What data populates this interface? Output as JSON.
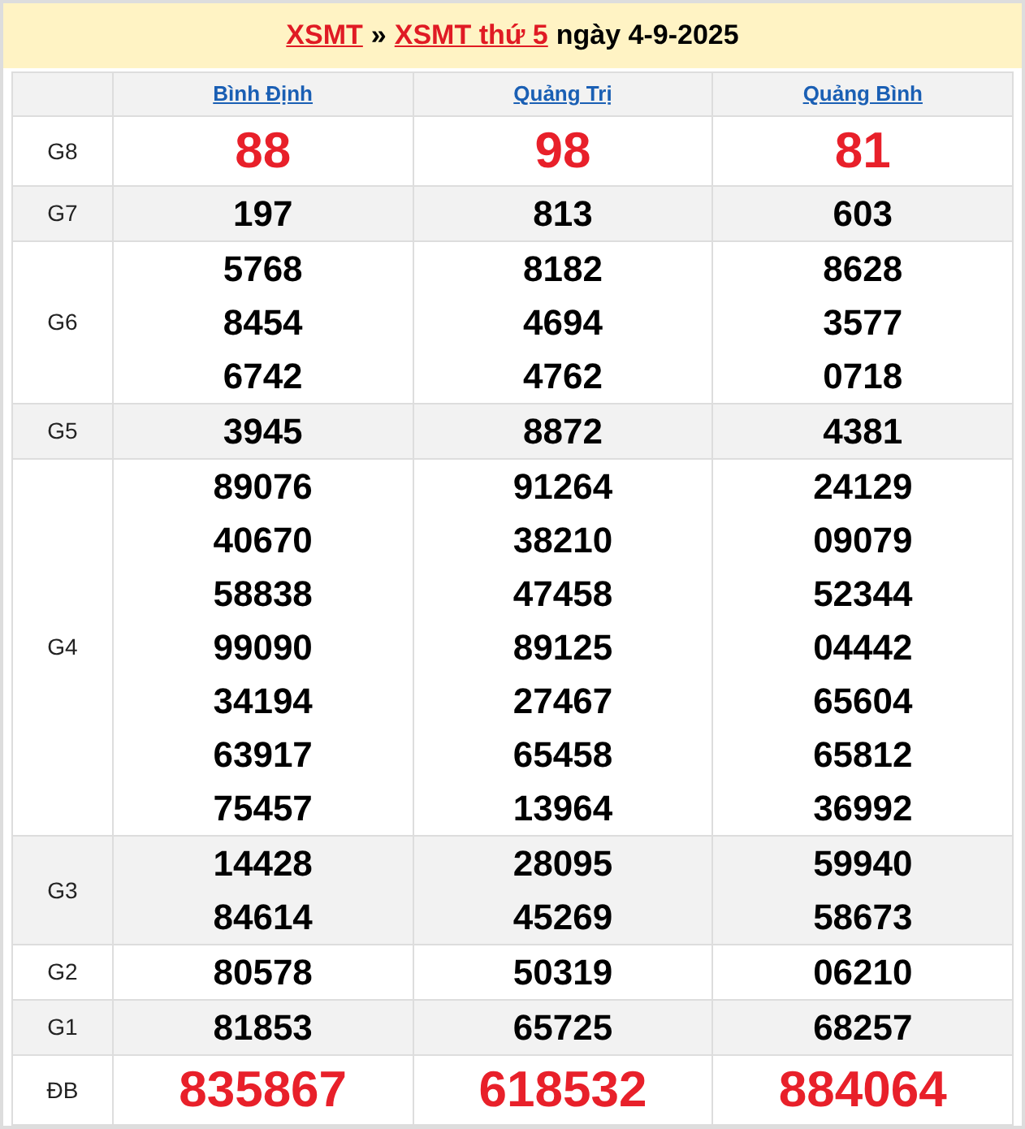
{
  "title": [
    {
      "kind": "link",
      "text": "XSMT"
    },
    {
      "kind": "text",
      "text": "»"
    },
    {
      "kind": "link",
      "text": "XSMT thứ 5"
    },
    {
      "kind": "text",
      "text": "ngày 4-9-2025"
    }
  ],
  "provinces": [
    "Bình Định",
    "Quảng Trị",
    "Quảng Bình"
  ],
  "prizes": [
    {
      "label": "G8",
      "highlight": true,
      "results": [
        [
          "88"
        ],
        [
          "98"
        ],
        [
          "81"
        ]
      ]
    },
    {
      "label": "G7",
      "highlight": false,
      "results": [
        [
          "197"
        ],
        [
          "813"
        ],
        [
          "603"
        ]
      ]
    },
    {
      "label": "G6",
      "highlight": false,
      "results": [
        [
          "5768",
          "8454",
          "6742"
        ],
        [
          "8182",
          "4694",
          "4762"
        ],
        [
          "8628",
          "3577",
          "0718"
        ]
      ]
    },
    {
      "label": "G5",
      "highlight": false,
      "results": [
        [
          "3945"
        ],
        [
          "8872"
        ],
        [
          "4381"
        ]
      ]
    },
    {
      "label": "G4",
      "highlight": false,
      "results": [
        [
          "89076",
          "40670",
          "58838",
          "99090",
          "34194",
          "63917",
          "75457"
        ],
        [
          "91264",
          "38210",
          "47458",
          "89125",
          "27467",
          "65458",
          "13964"
        ],
        [
          "24129",
          "09079",
          "52344",
          "04442",
          "65604",
          "65812",
          "36992"
        ]
      ]
    },
    {
      "label": "G3",
      "highlight": false,
      "results": [
        [
          "14428",
          "84614"
        ],
        [
          "28095",
          "45269"
        ],
        [
          "59940",
          "58673"
        ]
      ]
    },
    {
      "label": "G2",
      "highlight": false,
      "results": [
        [
          "80578"
        ],
        [
          "50319"
        ],
        [
          "06210"
        ]
      ]
    },
    {
      "label": "G1",
      "highlight": false,
      "results": [
        [
          "81853"
        ],
        [
          "65725"
        ],
        [
          "68257"
        ]
      ]
    },
    {
      "label": "ĐB",
      "highlight": true,
      "results": [
        [
          "835867"
        ],
        [
          "618532"
        ],
        [
          "884064"
        ]
      ]
    }
  ]
}
